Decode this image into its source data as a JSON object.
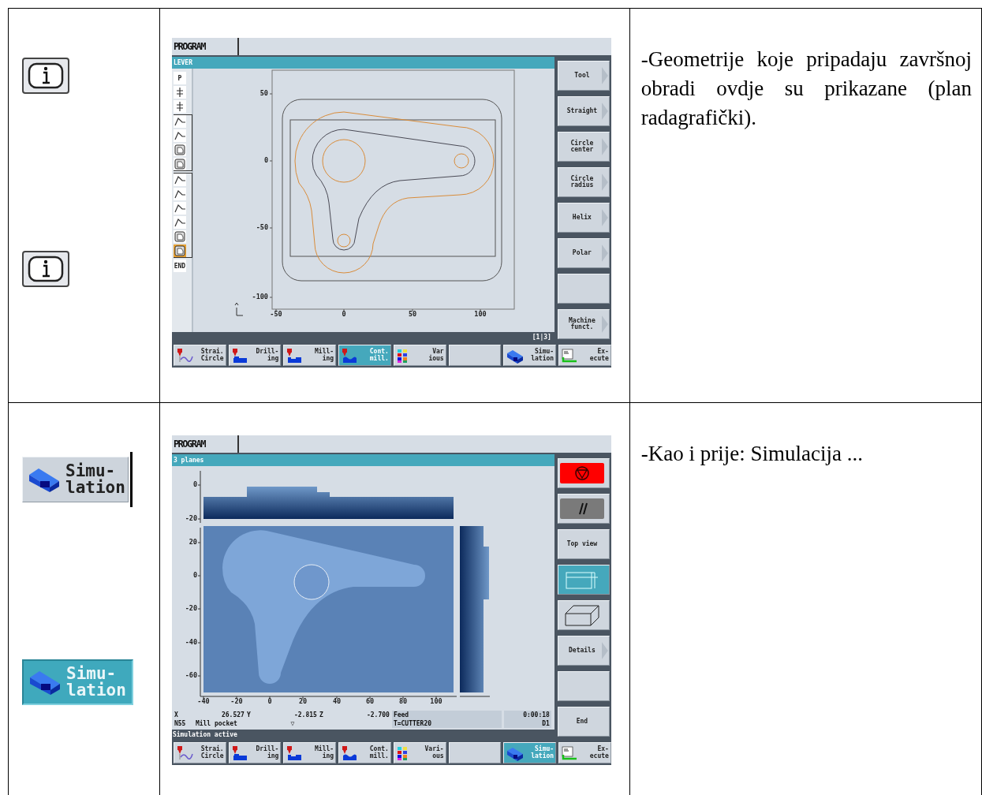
{
  "rows": [
    {
      "left": [
        {
          "kind": "info"
        },
        {
          "kind": "info"
        }
      ],
      "screen": {
        "kind": "contour",
        "header": "PROGRAM",
        "title": "LEVER",
        "steps": [
          {
            "kind": "start",
            "label": "P",
            "selected": false
          },
          {
            "kind": "drill",
            "selected": false
          },
          {
            "kind": "drill",
            "selected": false
          },
          {
            "kind": "group",
            "children": [
              {
                "kind": "contour",
                "selected": false
              },
              {
                "kind": "contour",
                "selected": false
              },
              {
                "kind": "pocket",
                "selected": false
              },
              {
                "kind": "pocket",
                "selected": false
              }
            ]
          },
          {
            "kind": "group",
            "children": [
              {
                "kind": "contour",
                "selected": false
              },
              {
                "kind": "contour",
                "selected": false
              },
              {
                "kind": "contour",
                "selected": false
              },
              {
                "kind": "contour",
                "selected": false
              },
              {
                "kind": "pocket",
                "selected": false
              },
              {
                "kind": "pocket",
                "selected": true
              }
            ]
          },
          {
            "kind": "end",
            "label": "END",
            "selected": false
          }
        ],
        "plot": {
          "y_ticks": [
            "50",
            "0",
            "-50",
            "-100"
          ],
          "x_ticks": [
            "-50",
            "0",
            "50",
            "100"
          ]
        },
        "page_indicator": "[1|3]",
        "side_keys": [
          {
            "kind": "text",
            "label": "Tool",
            "arrow": true,
            "selected": false
          },
          {
            "kind": "text",
            "label": "Straight",
            "arrow": true,
            "selected": false
          },
          {
            "kind": "text",
            "label": "Circle\ncenter",
            "arrow": true,
            "selected": false
          },
          {
            "kind": "text",
            "label": "Circle\nradius",
            "arrow": true,
            "selected": false
          },
          {
            "kind": "text",
            "label": "Helix",
            "arrow": true,
            "selected": false
          },
          {
            "kind": "text",
            "label": "Polar",
            "arrow": true,
            "selected": false
          },
          {
            "kind": "empty",
            "arrow": false,
            "selected": false
          },
          {
            "kind": "text",
            "label": "Machine\nfunct.",
            "arrow": true,
            "selected": false
          }
        ],
        "bottom_keys": [
          {
            "kind": "circle",
            "label": "Strai.\nCircle",
            "selected": false
          },
          {
            "kind": "drill",
            "label": "Drill-\ning",
            "selected": false
          },
          {
            "kind": "mill",
            "label": "Mill-\ning",
            "selected": false
          },
          {
            "kind": "contmill",
            "label": "Cont.\nmill.",
            "selected": true
          },
          {
            "kind": "various",
            "label": "Var\nious",
            "selected": false
          },
          {
            "kind": "empty",
            "selected": false
          },
          {
            "kind": "sim",
            "label": "Simu-\nlation",
            "selected": false
          },
          {
            "kind": "execute",
            "label": "Ex-\necute",
            "selected": false
          }
        ]
      },
      "text": "-Geometrije koje pripadaju završnoj obradi ovdje su prikazane (plan radagrafički)."
    },
    {
      "left": [
        {
          "kind": "softkey",
          "label": "Simu-\nlation",
          "selected": false,
          "marker_line": true
        },
        {
          "kind": "softkey",
          "label": "Simu-\nlation",
          "selected": true,
          "marker_line": false
        }
      ],
      "screen": {
        "kind": "simulation",
        "header": "PROGRAM",
        "title": "3 planes",
        "plot": {
          "z_ticks": [
            "0",
            "-20"
          ],
          "y_ticks": [
            "20",
            "0",
            "-20",
            "-40",
            "-60"
          ],
          "x_ticks": [
            "-40",
            "-20",
            "0",
            "20",
            "40",
            "60",
            "80",
            "100"
          ]
        },
        "status_lines": [
          [
            {
              "kind": "axis",
              "text": "X"
            },
            {
              "kind": "num",
              "text": "26.527"
            },
            {
              "kind": "axis",
              "text": "Y"
            },
            {
              "kind": "num",
              "text": "-2.815"
            },
            {
              "kind": "axis",
              "text": "Z"
            },
            {
              "kind": "num",
              "text": "-2.700"
            },
            {
              "kind": "field",
              "text": "Feed"
            },
            {
              "kind": "time",
              "text": "0:00:18"
            }
          ],
          [
            {
              "kind": "code",
              "text": "N55"
            },
            {
              "kind": "name",
              "text": "Mill pocket"
            },
            {
              "kind": "mark",
              "text": "▽"
            },
            {
              "kind": "field",
              "text": "T=CUTTER20"
            },
            {
              "kind": "time",
              "text": "D1"
            }
          ]
        ],
        "message": "Simulation active",
        "side_keys": [
          {
            "kind": "stop",
            "arrow": false,
            "selected": false
          },
          {
            "kind": "pause",
            "arrow": false,
            "selected": false
          },
          {
            "kind": "text",
            "label": "Top view",
            "arrow": false,
            "selected": false
          },
          {
            "kind": "planes",
            "arrow": false,
            "selected": true
          },
          {
            "kind": "cube",
            "arrow": false,
            "selected": false
          },
          {
            "kind": "text",
            "label": "Details",
            "arrow": true,
            "selected": false
          },
          {
            "kind": "empty",
            "arrow": false,
            "selected": false
          },
          {
            "kind": "text",
            "label": "End",
            "arrow": false,
            "selected": false
          }
        ],
        "bottom_keys": [
          {
            "kind": "circle",
            "label": "Strai.\nCircle",
            "selected": false
          },
          {
            "kind": "drill",
            "label": "Drill-\ning",
            "selected": false
          },
          {
            "kind": "mill",
            "label": "Mill-\ning",
            "selected": false
          },
          {
            "kind": "contmill",
            "label": "Cont.\nmill.",
            "selected": false
          },
          {
            "kind": "various",
            "label": "Vari-\nous",
            "selected": false
          },
          {
            "kind": "empty",
            "selected": false
          },
          {
            "kind": "sim",
            "label": "Simu-\nlation",
            "selected": true
          },
          {
            "kind": "execute",
            "label": "Ex-\necute",
            "selected": false
          }
        ]
      },
      "text": "-Kao i prije: Simulacija ..."
    }
  ]
}
